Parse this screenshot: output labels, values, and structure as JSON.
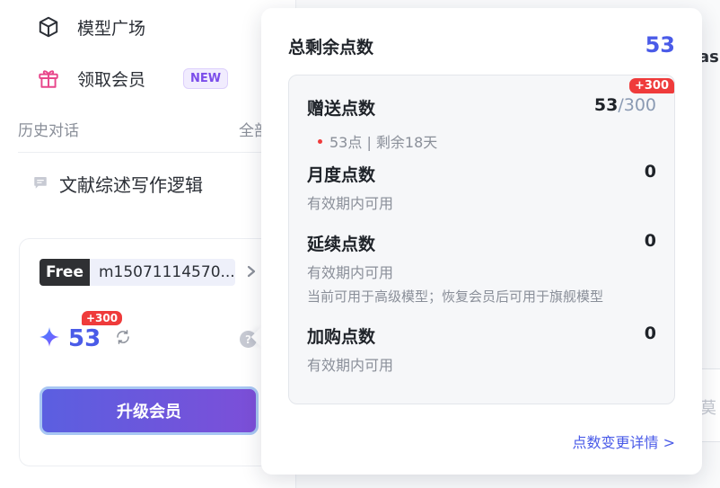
{
  "sidebar": {
    "nav": [
      {
        "label": "模型广场",
        "icon": "cube-icon"
      },
      {
        "label": "领取会员",
        "icon": "gift-icon",
        "badge": "NEW"
      }
    ],
    "history_label": "历史对话",
    "history_all": "全部",
    "history_items": [
      {
        "label": "文献综述写作逻辑",
        "icon": "chat-bubble-icon"
      }
    ]
  },
  "account": {
    "plan": "Free",
    "user": "m15071114570...",
    "points": "53",
    "points_badge": "+300",
    "upgrade_label": "升级会员"
  },
  "background": {
    "text_top": "as",
    "text_bottom": "莫"
  },
  "popover": {
    "title": "总剩余点数",
    "total": "53",
    "sections": [
      {
        "title": "赠送点数",
        "value": "53",
        "value_total": "/300",
        "badge": "+300",
        "note": "53点 | 剩余18天"
      },
      {
        "title": "月度点数",
        "value": "0",
        "sub": "有效期内可用"
      },
      {
        "title": "延续点数",
        "value": "0",
        "sub": "有效期内可用",
        "sub2": "当前可用于高级模型；恢复会员后可用于旗舰模型"
      },
      {
        "title": "加购点数",
        "value": "0",
        "sub": "有效期内可用"
      }
    ],
    "details_link": "点数变更详情 >"
  },
  "colors": {
    "accent": "#4a5be8",
    "badge_red": "#ef3b3b",
    "new_badge": "#7b4dea"
  }
}
